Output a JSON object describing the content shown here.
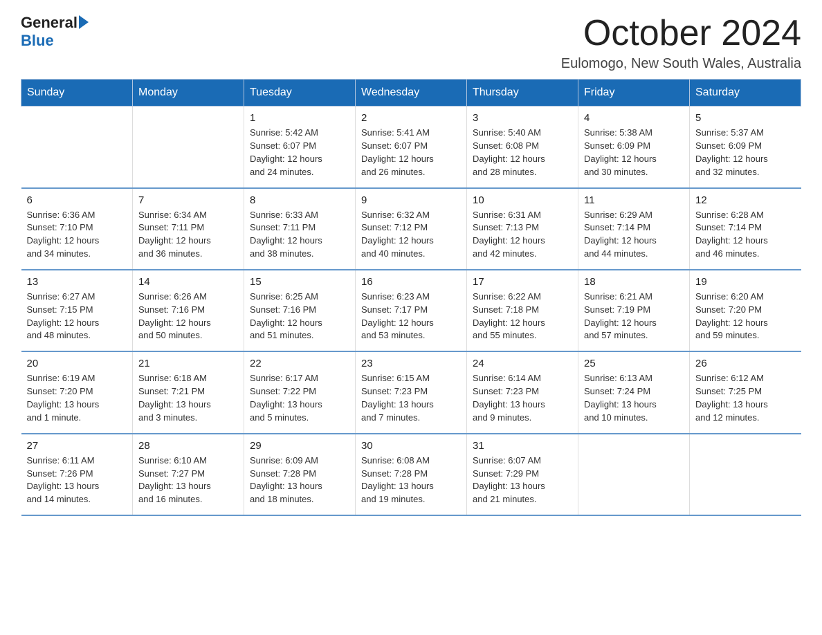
{
  "header": {
    "logo_general": "General",
    "logo_blue": "Blue",
    "month_title": "October 2024",
    "location": "Eulomogo, New South Wales, Australia"
  },
  "calendar": {
    "weekdays": [
      "Sunday",
      "Monday",
      "Tuesday",
      "Wednesday",
      "Thursday",
      "Friday",
      "Saturday"
    ],
    "weeks": [
      [
        {
          "day": "",
          "info": ""
        },
        {
          "day": "",
          "info": ""
        },
        {
          "day": "1",
          "info": "Sunrise: 5:42 AM\nSunset: 6:07 PM\nDaylight: 12 hours\nand 24 minutes."
        },
        {
          "day": "2",
          "info": "Sunrise: 5:41 AM\nSunset: 6:07 PM\nDaylight: 12 hours\nand 26 minutes."
        },
        {
          "day": "3",
          "info": "Sunrise: 5:40 AM\nSunset: 6:08 PM\nDaylight: 12 hours\nand 28 minutes."
        },
        {
          "day": "4",
          "info": "Sunrise: 5:38 AM\nSunset: 6:09 PM\nDaylight: 12 hours\nand 30 minutes."
        },
        {
          "day": "5",
          "info": "Sunrise: 5:37 AM\nSunset: 6:09 PM\nDaylight: 12 hours\nand 32 minutes."
        }
      ],
      [
        {
          "day": "6",
          "info": "Sunrise: 6:36 AM\nSunset: 7:10 PM\nDaylight: 12 hours\nand 34 minutes."
        },
        {
          "day": "7",
          "info": "Sunrise: 6:34 AM\nSunset: 7:11 PM\nDaylight: 12 hours\nand 36 minutes."
        },
        {
          "day": "8",
          "info": "Sunrise: 6:33 AM\nSunset: 7:11 PM\nDaylight: 12 hours\nand 38 minutes."
        },
        {
          "day": "9",
          "info": "Sunrise: 6:32 AM\nSunset: 7:12 PM\nDaylight: 12 hours\nand 40 minutes."
        },
        {
          "day": "10",
          "info": "Sunrise: 6:31 AM\nSunset: 7:13 PM\nDaylight: 12 hours\nand 42 minutes."
        },
        {
          "day": "11",
          "info": "Sunrise: 6:29 AM\nSunset: 7:14 PM\nDaylight: 12 hours\nand 44 minutes."
        },
        {
          "day": "12",
          "info": "Sunrise: 6:28 AM\nSunset: 7:14 PM\nDaylight: 12 hours\nand 46 minutes."
        }
      ],
      [
        {
          "day": "13",
          "info": "Sunrise: 6:27 AM\nSunset: 7:15 PM\nDaylight: 12 hours\nand 48 minutes."
        },
        {
          "day": "14",
          "info": "Sunrise: 6:26 AM\nSunset: 7:16 PM\nDaylight: 12 hours\nand 50 minutes."
        },
        {
          "day": "15",
          "info": "Sunrise: 6:25 AM\nSunset: 7:16 PM\nDaylight: 12 hours\nand 51 minutes."
        },
        {
          "day": "16",
          "info": "Sunrise: 6:23 AM\nSunset: 7:17 PM\nDaylight: 12 hours\nand 53 minutes."
        },
        {
          "day": "17",
          "info": "Sunrise: 6:22 AM\nSunset: 7:18 PM\nDaylight: 12 hours\nand 55 minutes."
        },
        {
          "day": "18",
          "info": "Sunrise: 6:21 AM\nSunset: 7:19 PM\nDaylight: 12 hours\nand 57 minutes."
        },
        {
          "day": "19",
          "info": "Sunrise: 6:20 AM\nSunset: 7:20 PM\nDaylight: 12 hours\nand 59 minutes."
        }
      ],
      [
        {
          "day": "20",
          "info": "Sunrise: 6:19 AM\nSunset: 7:20 PM\nDaylight: 13 hours\nand 1 minute."
        },
        {
          "day": "21",
          "info": "Sunrise: 6:18 AM\nSunset: 7:21 PM\nDaylight: 13 hours\nand 3 minutes."
        },
        {
          "day": "22",
          "info": "Sunrise: 6:17 AM\nSunset: 7:22 PM\nDaylight: 13 hours\nand 5 minutes."
        },
        {
          "day": "23",
          "info": "Sunrise: 6:15 AM\nSunset: 7:23 PM\nDaylight: 13 hours\nand 7 minutes."
        },
        {
          "day": "24",
          "info": "Sunrise: 6:14 AM\nSunset: 7:23 PM\nDaylight: 13 hours\nand 9 minutes."
        },
        {
          "day": "25",
          "info": "Sunrise: 6:13 AM\nSunset: 7:24 PM\nDaylight: 13 hours\nand 10 minutes."
        },
        {
          "day": "26",
          "info": "Sunrise: 6:12 AM\nSunset: 7:25 PM\nDaylight: 13 hours\nand 12 minutes."
        }
      ],
      [
        {
          "day": "27",
          "info": "Sunrise: 6:11 AM\nSunset: 7:26 PM\nDaylight: 13 hours\nand 14 minutes."
        },
        {
          "day": "28",
          "info": "Sunrise: 6:10 AM\nSunset: 7:27 PM\nDaylight: 13 hours\nand 16 minutes."
        },
        {
          "day": "29",
          "info": "Sunrise: 6:09 AM\nSunset: 7:28 PM\nDaylight: 13 hours\nand 18 minutes."
        },
        {
          "day": "30",
          "info": "Sunrise: 6:08 AM\nSunset: 7:28 PM\nDaylight: 13 hours\nand 19 minutes."
        },
        {
          "day": "31",
          "info": "Sunrise: 6:07 AM\nSunset: 7:29 PM\nDaylight: 13 hours\nand 21 minutes."
        },
        {
          "day": "",
          "info": ""
        },
        {
          "day": "",
          "info": ""
        }
      ]
    ]
  }
}
